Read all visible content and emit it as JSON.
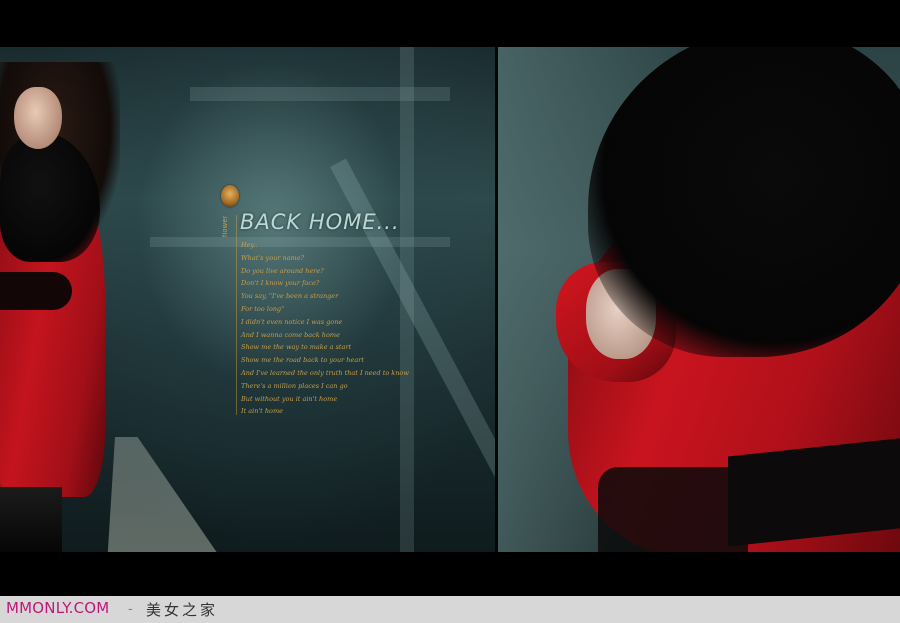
{
  "photo": {
    "title": "BACK HOME...",
    "vertical_tag": "flower",
    "poem_lines": [
      "Hey..",
      "What's your name?",
      "Do you live around here?",
      "Don't I know your face?",
      "You say, \"I've been a stranger",
      "For too long\"",
      "I didn't even notice I was gone",
      "And I wanna come back home",
      "Show me the way to make a start",
      "Show me the road back to your heart",
      "And I've learned the only truth that I need to know",
      "There's a million places I can go",
      "But without you it ain't home",
      "It ain't home"
    ]
  },
  "watermark": {
    "site": "MMONLY.COM",
    "separator": "-",
    "cn_text": "美女之家"
  },
  "colors": {
    "coat_red": "#c4141e",
    "text_gold": "#c79e47",
    "title_teal": "#b9d8d6",
    "watermark_pink": "#c0187a",
    "watermark_dash": "#4b8ec9"
  }
}
